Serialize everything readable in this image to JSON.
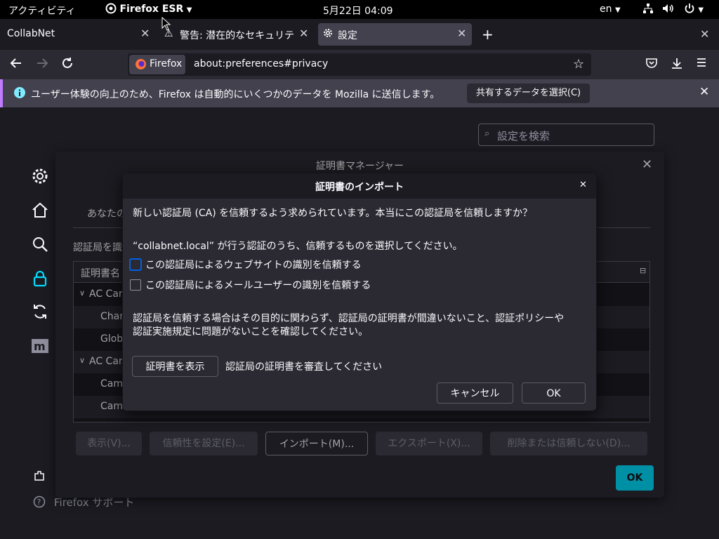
{
  "topbar": {
    "activities": "アクティビティ",
    "app_name": "Firefox ESR",
    "clock": "5月22日 04:09",
    "lang": "en"
  },
  "tabs": [
    {
      "label": "CollabNet"
    },
    {
      "label": "警告: 潜在的なセキュリテ"
    },
    {
      "label": "設定"
    }
  ],
  "navbar": {
    "identity_label": "Firefox",
    "url": "about:preferences#privacy"
  },
  "notification": {
    "message": "ユーザー体験の向上のため、Firefox は自動的にいくつかのデータを Mozilla に送信します。",
    "choose_label": "共有するデータを選択(C)"
  },
  "prefs": {
    "search_placeholder": "設定を検索",
    "support_label": "Firefox サポート"
  },
  "cert_manager": {
    "title": "証明書マネージャー",
    "intro_partial": "あなたの",
    "ca_partial": "認証局を識",
    "column_header": "証明書名",
    "rows": [
      {
        "label": "AC Car",
        "group": true
      },
      {
        "label": "Char",
        "group": false
      },
      {
        "label": "Glob",
        "group": false
      },
      {
        "label": "AC Car",
        "group": true
      },
      {
        "label": "Cam",
        "group": false
      },
      {
        "label": "Cam",
        "group": false
      }
    ],
    "buttons": {
      "view": "表示(V)...",
      "trust": "信頼性を設定(E)...",
      "import": "インポート(M)...",
      "export": "エクスポート(X)...",
      "delete": "削除または信頼しない(D)..."
    },
    "ok_label": "OK"
  },
  "import_dialog": {
    "title": "証明書のインポート",
    "question": "新しい認証局 (CA) を信頼するよう求められています。本当にこの認証局を信頼しますか？",
    "select_prompt": "“collabnet.local” が行う認証のうち、信頼するものを選択してください。",
    "trust_web": "この認証局によるウェブサイトの識別を信頼する",
    "trust_email": "この認証局によるメールユーザーの識別を信頼する",
    "warning_line1": "認証局を信頼する場合はその目的に関わらず、認証局の証明書が間違いないこと、認証ポリシーや",
    "warning_line2": "認証実施規定に問題がないことを確認してください。",
    "view_cert_button": "証明書を表示",
    "view_cert_hint": "認証局の証明書を審査してください",
    "cancel_label": "キャンセル",
    "ok_label": "OK"
  },
  "colors": {
    "accent": "#00ddff",
    "tab_selected": "#42414d",
    "toolbar": "#2b2a33",
    "page_bg": "#1c1b22",
    "notif_border": "#c07cff",
    "info_blue": "#80ebff"
  }
}
